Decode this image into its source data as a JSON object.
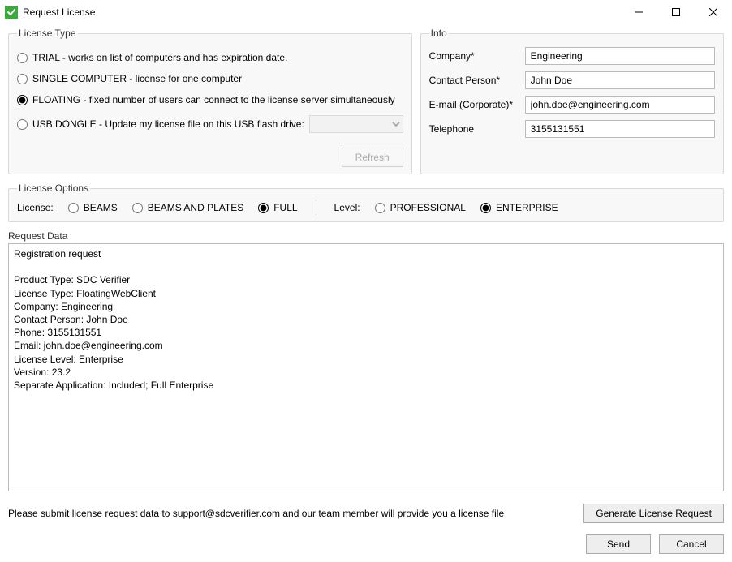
{
  "window": {
    "title": "Request License"
  },
  "licenseType": {
    "legend": "License Type",
    "options": {
      "trial": "TRIAL -  works on list of computers and has expiration date.",
      "single": "SINGLE COMPUTER - license for one computer",
      "floating": "FLOATING - fixed number of users can connect to the license server simultaneously",
      "usb": "USB DONGLE - Update my license file on this USB flash drive:"
    },
    "selected": "floating",
    "refresh_label": "Refresh"
  },
  "info": {
    "legend": "Info",
    "fields": {
      "company": {
        "label": "Company*",
        "value": "Engineering"
      },
      "contact": {
        "label": "Contact Person*",
        "value": "John Doe"
      },
      "email": {
        "label": "E-mail (Corporate)*",
        "value": "john.doe@engineering.com"
      },
      "phone": {
        "label": "Telephone",
        "value": "3155131551"
      }
    }
  },
  "options": {
    "legend": "License Options",
    "license_label": "License:",
    "license": {
      "beams": "BEAMS",
      "beams_plates": "BEAMS AND PLATES",
      "full": "FULL"
    },
    "license_selected": "full",
    "level_label": "Level:",
    "level": {
      "professional": "PROFESSIONAL",
      "enterprise": "ENTERPRISE"
    },
    "level_selected": "enterprise"
  },
  "requestData": {
    "legend": "Request Data",
    "text": "Registration request\n\nProduct Type: SDC Verifier\nLicense Type: FloatingWebClient\nCompany: Engineering\nContact Person: John Doe\nPhone: 3155131551\nEmail: john.doe@engineering.com\nLicense Level: Enterprise\nVersion: 23.2\nSeparate Application: Included; Full Enterprise"
  },
  "footer": {
    "instruction": "Please submit license request data to support@sdcverifier.com and our team member will provide you a license file",
    "generate_label": "Generate License Request",
    "send_label": "Send",
    "cancel_label": "Cancel"
  }
}
